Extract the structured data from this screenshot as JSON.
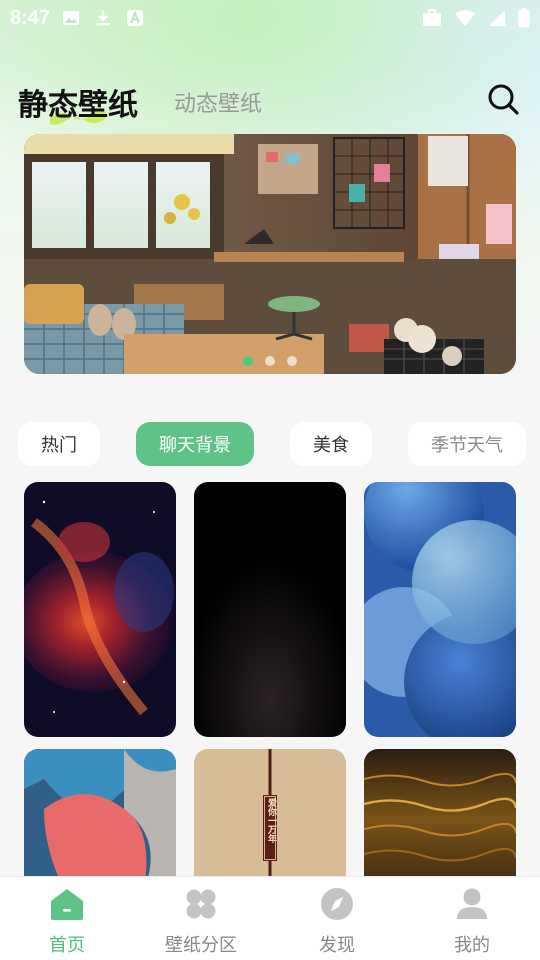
{
  "status_bar": {
    "time": "8:47"
  },
  "header": {
    "tab_static": "静态壁纸",
    "tab_dynamic": "动态壁纸"
  },
  "banner": {
    "dot_count": 3,
    "active_dot": 1
  },
  "categories": [
    {
      "label": "热门",
      "active": false
    },
    {
      "label": "聊天背景",
      "active": true
    },
    {
      "label": "美食",
      "active": false
    },
    {
      "label": "季节天气",
      "active": false
    }
  ],
  "wallpapers": [
    {
      "name": "nebula"
    },
    {
      "name": "dark-gradient"
    },
    {
      "name": "blue-spheres"
    },
    {
      "name": "abstract-brushstrokes"
    },
    {
      "name": "love-you-forever",
      "text": "爱你一万年"
    },
    {
      "name": "golden-water"
    }
  ],
  "bottom_nav": [
    {
      "label": "首页",
      "icon": "home-icon",
      "active": true
    },
    {
      "label": "壁纸分区",
      "icon": "grid-icon",
      "active": false
    },
    {
      "label": "发现",
      "icon": "compass-icon",
      "active": false
    },
    {
      "label": "我的",
      "icon": "user-icon",
      "active": false
    }
  ],
  "colors": {
    "accent": "#5fc387",
    "nav_active": "#52bf7a",
    "dot_active": "#4cc879"
  }
}
